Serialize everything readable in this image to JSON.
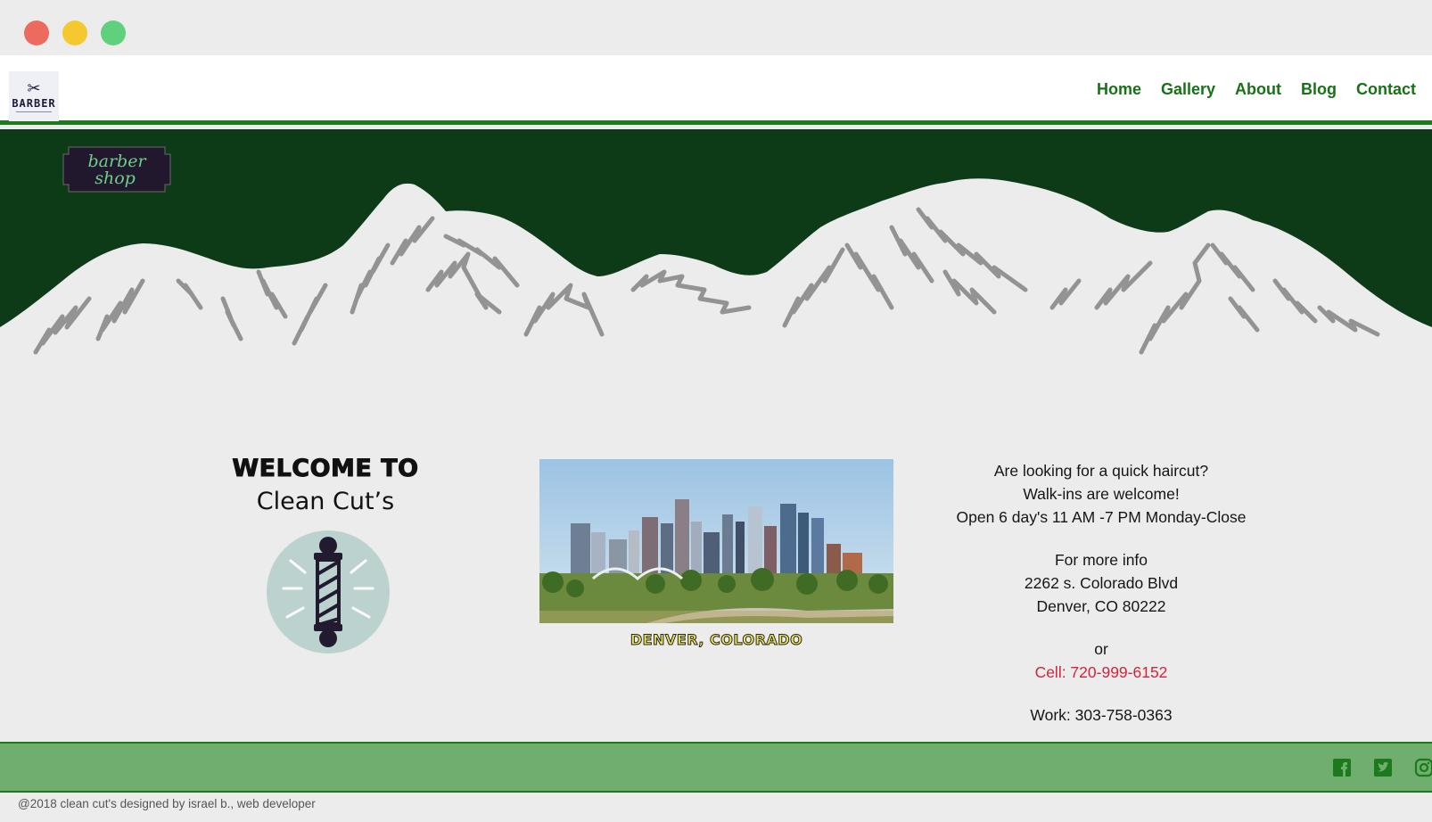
{
  "window": {
    "controls": [
      "close",
      "minimize",
      "maximize"
    ]
  },
  "header": {
    "logo_text": "BARBER",
    "nav": [
      "Home",
      "Gallery",
      "About",
      "Blog",
      "Contact"
    ]
  },
  "hero": {
    "badge_line1": "barber",
    "badge_line2": "shop"
  },
  "welcome": {
    "line1": "WELCOME TO",
    "line2": "Clean Cut’s"
  },
  "photo": {
    "caption": "DENVER, COLORADO"
  },
  "info": {
    "line1": "Are looking for a quick haircut?",
    "line2": "Walk-ins are welcome!",
    "line3": "Open 6 day's 11 AM -7 PM Monday-Close",
    "line4": "For more info",
    "line5": "2262 s. Colorado Blvd",
    "line6": "Denver, CO 80222",
    "line7": "or",
    "cell": "Cell: 720-999-6152",
    "work": "Work: 303-758-0363"
  },
  "footer": {
    "social_icons": [
      "facebook-icon",
      "twitter-icon",
      "instagram-icon"
    ],
    "copyright": "@2018 clean cut's designed by israel b., web developer"
  },
  "colors": {
    "nav_green": "#177217",
    "hero_green": "#0d3a17",
    "footer_green": "#6fae6f",
    "cell_red": "#d2243c"
  }
}
